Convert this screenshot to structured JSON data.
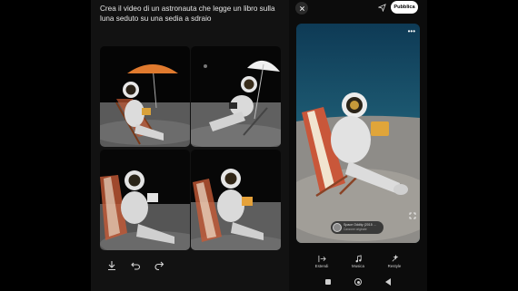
{
  "prompt": {
    "text": "Crea il video di un astronauta che legge un libro sulla luna seduto su una sedia a sdraio"
  },
  "left_toolbar": {
    "download_icon": "download-icon",
    "undo_icon": "undo-icon",
    "share_icon": "share-arrow-icon"
  },
  "header": {
    "close_icon": "close-icon",
    "send_icon": "send-icon",
    "publish_label": "Pubblica"
  },
  "preview": {
    "more_label": "•••",
    "music": {
      "title": "Space Oddity (2015 ...",
      "subtitle": "Canzone originale"
    }
  },
  "tools": [
    {
      "icon": "extend-icon",
      "label": "Estendi"
    },
    {
      "icon": "music-note-icon",
      "label": "Musica"
    },
    {
      "icon": "restyle-icon",
      "label": "Restyle"
    }
  ],
  "colors": {
    "publish_bg": "#ffffff",
    "background": "#121212"
  }
}
